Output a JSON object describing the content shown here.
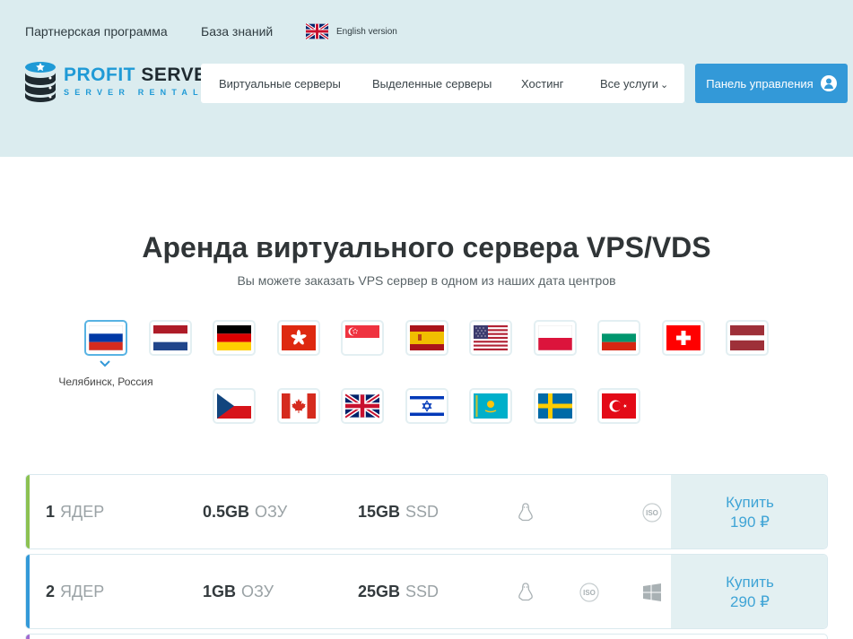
{
  "header": {
    "top_links": {
      "partner": "Партнерская программа",
      "knowledge_base": "База знаний",
      "english": "English version"
    },
    "logo": {
      "word1": "PROFIT",
      "word2": "SERVER",
      "sub": "SERVER RENTAL"
    },
    "nav": {
      "vps": "Виртуальные серверы",
      "dedicated": "Выделенные серверы",
      "hosting": "Хостинг",
      "all_services": "Все услуги"
    },
    "panel_button": "Панель управления"
  },
  "hero": {
    "title": "Аренда виртуального сервера VPS/VDS",
    "subtitle": "Вы можете заказать VPS сервер в одном из наших дата центров"
  },
  "locations": {
    "selected_caption": "Челябинск, Россия",
    "flags_row1": [
      "russia-flag",
      "netherlands-flag",
      "germany-flag",
      "hongkong-flag",
      "singapore-flag",
      "spain-flag",
      "usa-flag",
      "poland-flag",
      "bulgaria-flag",
      "switzerland-flag",
      "latvia-flag"
    ],
    "flags_row2": [
      "czech-flag",
      "canada-flag",
      "uk-flag",
      "israel-flag",
      "kazakhstan-flag",
      "sweden-flag",
      "turkey-flag"
    ]
  },
  "plans": [
    {
      "cores": "1",
      "cores_label": "ЯДЕР",
      "ram": "0.5GB",
      "ram_label": "ОЗУ",
      "disk": "15GB",
      "disk_label": "SSD",
      "buy_label": "Купить",
      "price": "190 ₽",
      "accent": "#8cc152"
    },
    {
      "cores": "2",
      "cores_label": "ЯДЕР",
      "ram": "1GB",
      "ram_label": "ОЗУ",
      "disk": "25GB",
      "disk_label": "SSD",
      "buy_label": "Купить",
      "price": "290 ₽",
      "accent": "#3399d8"
    }
  ],
  "colors": {
    "header_bg": "#dbecef",
    "primary": "#3399d8",
    "buy_bg": "#e3f0f2"
  }
}
